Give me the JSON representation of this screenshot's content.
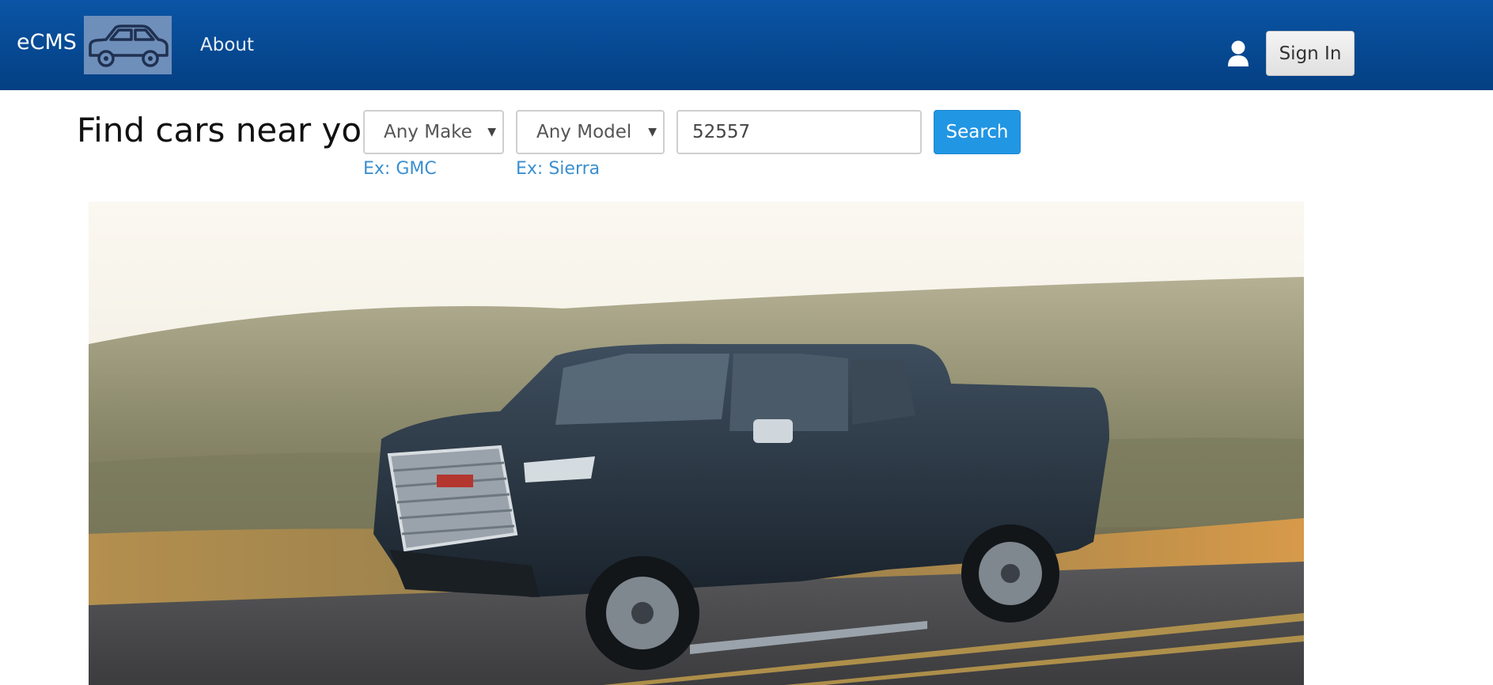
{
  "navbar": {
    "brand": "eCMS",
    "logo_icon": "car-icon",
    "about_label": "About",
    "user_icon": "user-icon",
    "signin_label": "Sign In",
    "colors": {
      "bar_top": "#0a55a6",
      "bar_bottom": "#043f82"
    }
  },
  "search": {
    "title": "Find cars near you",
    "make": {
      "selected": "Any Make",
      "hint": "Ex: GMC"
    },
    "model": {
      "selected": "Any Model",
      "hint": "Ex: Sierra"
    },
    "zip": {
      "value": "52557"
    },
    "button_label": "Search",
    "accent_color": "#2196e3"
  },
  "hero": {
    "image_label": "GMC Sierra pickup truck driving on road"
  }
}
